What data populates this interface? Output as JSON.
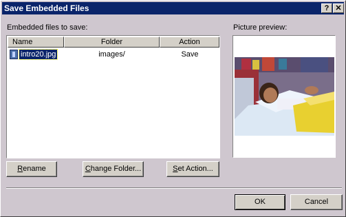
{
  "window": {
    "title": "Save Embedded Files",
    "help_label": "?",
    "close_label": "✕"
  },
  "files_section": {
    "label": "Embedded files to save:",
    "columns": [
      "Name",
      "Folder",
      "Action"
    ],
    "rows": [
      {
        "name": "intro20.jpg",
        "folder": "images/",
        "action": "Save",
        "icon": "image-file-icon",
        "selected": true
      }
    ]
  },
  "preview": {
    "label": "Picture preview:"
  },
  "buttons": {
    "rename": {
      "hot": "R",
      "rest": "ename"
    },
    "change_folder": {
      "hot": "C",
      "rest": "hange Folder..."
    },
    "set_action": {
      "hot": "S",
      "rest": "et Action..."
    },
    "ok": "OK",
    "cancel": "Cancel"
  },
  "colors": {
    "titlebar": "#0a246a",
    "dialog": "#cfc7cf",
    "selection": "#0a246a"
  }
}
